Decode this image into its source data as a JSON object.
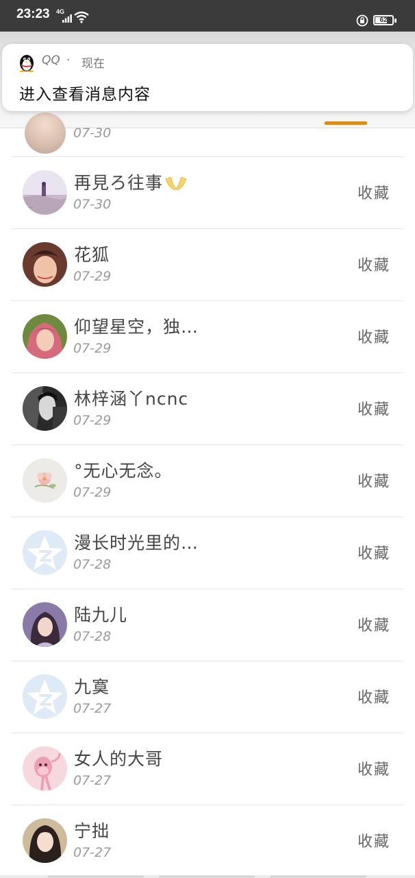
{
  "status_bar": {
    "time": "23:23",
    "network": "4G",
    "battery": "62"
  },
  "notification": {
    "app": "QQ",
    "separator": "·",
    "time": "现在",
    "message": "进入查看消息内容"
  },
  "partial_row": {
    "date": "07-30"
  },
  "colors": {
    "accent": "#e88a00",
    "status_bar_bg": "#3b3b3b",
    "name_text": "#444444",
    "date_text": "#9a9a9a"
  },
  "collect_label": "收藏",
  "rows": [
    {
      "name": "再見ろ往事",
      "date": "07-30",
      "avatar": "avatar-1"
    },
    {
      "name": "花狐",
      "date": "07-29",
      "avatar": "avatar-2"
    },
    {
      "name": "仰望星空，独…",
      "date": "07-29",
      "avatar": "avatar-3"
    },
    {
      "name": "林梓涵丫ncnc",
      "date": "07-29",
      "avatar": "avatar-4"
    },
    {
      "name": "°无心无念。",
      "date": "07-29",
      "avatar": "avatar-5"
    },
    {
      "name": "漫长时光里的…",
      "date": "07-28",
      "avatar": "default-qzone-icon"
    },
    {
      "name": "陆九儿",
      "date": "07-28",
      "avatar": "avatar-7"
    },
    {
      "name": "九寞",
      "date": "07-27",
      "avatar": "default-qzone-icon"
    },
    {
      "name": "女人的大哥",
      "date": "07-27",
      "avatar": "pink-panther-avatar"
    },
    {
      "name": "宁拙",
      "date": "07-27",
      "avatar": "avatar-10"
    }
  ]
}
